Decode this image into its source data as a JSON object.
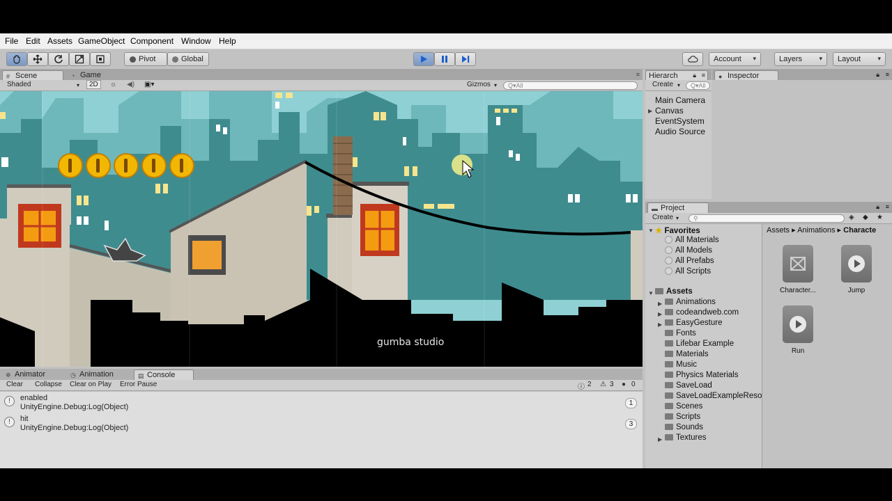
{
  "menu": [
    "File",
    "Edit",
    "Assets",
    "GameObject",
    "Component",
    "Window",
    "Help"
  ],
  "toolbar": {
    "pivot_label": "Pivot",
    "global_label": "Global",
    "account_label": "Account",
    "layers_label": "Layers",
    "layout_label": "Layout"
  },
  "scene_panel": {
    "tabs": [
      "Scene",
      "Game"
    ],
    "shading_mode": "Shaded",
    "mode_2d": "2D",
    "gizmos_label": "Gizmos",
    "search_placeholder": "Q▾All"
  },
  "scene_view": {
    "watermark": "gumba studio",
    "coin_count": 5,
    "colors": {
      "sky": "#8fd0d4",
      "far_buildings": "#6eb7bb",
      "near_buildings": "#3f8c8f",
      "roofs": "#d0cbbd",
      "foreground": "#000000",
      "coin": "#f2b705"
    }
  },
  "bottom_panel": {
    "tabs": [
      "Animator",
      "Animation",
      "Console"
    ],
    "buttons": [
      "Clear",
      "Collapse",
      "Clear on Play",
      "Error Pause"
    ],
    "counts": {
      "warnings": "2",
      "messages": "3",
      "errors": "0"
    },
    "log": [
      {
        "line1": "enabled",
        "line2": "UnityEngine.Debug:Log(Object)",
        "count": "1"
      },
      {
        "line1": "hit",
        "line2": "UnityEngine.Debug:Log(Object)",
        "count": "3"
      }
    ]
  },
  "hierarchy": {
    "tab": "Hierarch",
    "create_label": "Create",
    "search_placeholder": "Q▾All",
    "items": [
      "Main Camera",
      "Canvas",
      "EventSystem",
      "Audio Source"
    ]
  },
  "inspector": {
    "tab": "Inspector"
  },
  "project": {
    "tab": "Project",
    "create_label": "Create",
    "favorites_label": "Favorites",
    "favorites": [
      "All Materials",
      "All Models",
      "All Prefabs",
      "All Scripts"
    ],
    "assets_label": "Assets",
    "folders": [
      "Animations",
      "codeandweb.com",
      "EasyGesture",
      "Fonts",
      "Lifebar Example",
      "Materials",
      "Music",
      "Physics Materials",
      "SaveLoad",
      "SaveLoadExampleReso",
      "Scenes",
      "Scripts",
      "Sounds",
      "Textures"
    ],
    "breadcrumb": [
      "Assets",
      "Animations",
      "Characte"
    ],
    "assets": [
      {
        "label": "Character...",
        "kind": "animator-controller"
      },
      {
        "label": "Jump",
        "kind": "animation-clip"
      },
      {
        "label": "Run",
        "kind": "animation-clip"
      }
    ]
  }
}
